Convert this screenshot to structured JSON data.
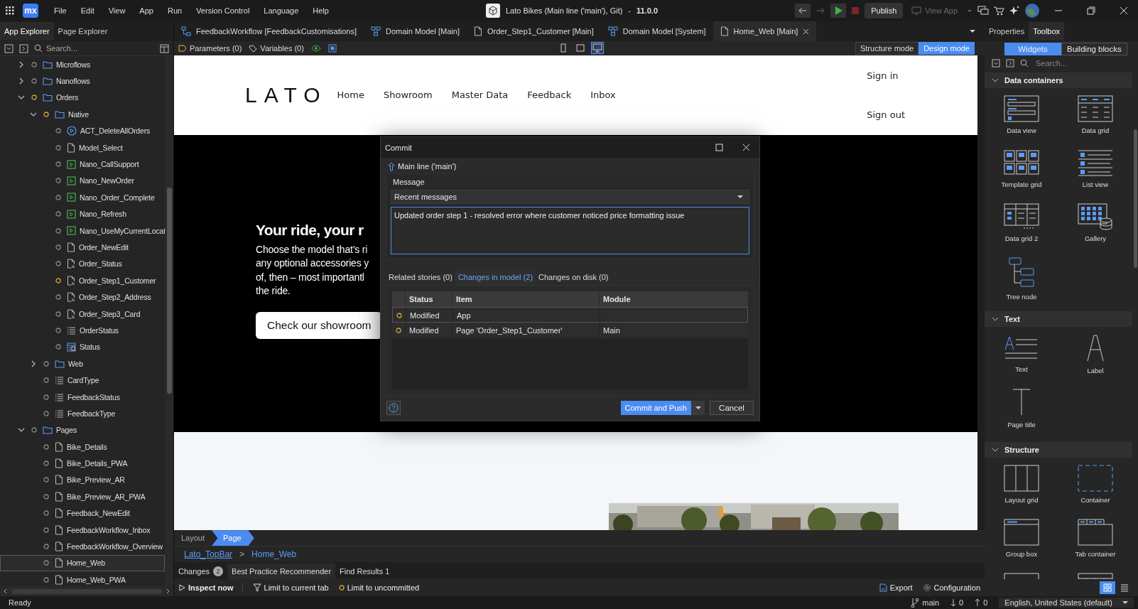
{
  "titlebar": {
    "logo": "mx",
    "menu": [
      "File",
      "Edit",
      "View",
      "App",
      "Run",
      "Version Control",
      "Language",
      "Help"
    ],
    "app_title": "Lato Bikes (Main line ('main'), Git)",
    "separator": "-",
    "version": "11.0.0",
    "publish": "Publish",
    "view_app": {
      "label": "View App",
      "disabled": true
    }
  },
  "explorer": {
    "tabs": [
      {
        "label": "App Explorer",
        "selected": true
      },
      {
        "label": "Page Explorer",
        "selected": false
      }
    ],
    "search": {
      "placeholder": "Search..."
    },
    "tree": [
      {
        "label": "Microflows",
        "kind": "folder",
        "modified": false,
        "expanded": false,
        "selected": false
      },
      {
        "label": "Nanoflows",
        "kind": "folder",
        "modified": false,
        "expanded": false,
        "selected": false
      },
      {
        "label": "Orders",
        "kind": "folder",
        "modified": true,
        "expanded": true,
        "selected": false,
        "children": [
          {
            "label": "Native",
            "kind": "folder",
            "modified": true,
            "expanded": true,
            "selected": false,
            "children": [
              {
                "label": "ACT_DeleteAllOrders",
                "kind": "microflow",
                "modified": false,
                "selected": false
              },
              {
                "label": "Model_Select",
                "kind": "page",
                "modified": false,
                "selected": false
              },
              {
                "label": "Nano_CallSupport",
                "kind": "nanoflow",
                "modified": false,
                "selected": false
              },
              {
                "label": "Nano_NewOrder",
                "kind": "nanoflow",
                "modified": false,
                "selected": false
              },
              {
                "label": "Nano_Order_Complete",
                "kind": "nanoflow",
                "modified": false,
                "selected": false
              },
              {
                "label": "Nano_Refresh",
                "kind": "nanoflow",
                "modified": false,
                "selected": false
              },
              {
                "label": "Nano_UseMyCurrentLocat",
                "kind": "nanoflow",
                "modified": false,
                "selected": false
              },
              {
                "label": "Order_NewEdit",
                "kind": "page",
                "modified": false,
                "selected": false
              },
              {
                "label": "Order_Status",
                "kind": "page-params",
                "modified": false,
                "selected": false
              },
              {
                "label": "Order_Step1_Customer",
                "kind": "page-params",
                "modified": true,
                "selected": false
              },
              {
                "label": "Order_Step2_Address",
                "kind": "page-params",
                "modified": false,
                "selected": false
              },
              {
                "label": "Order_Step3_Card",
                "kind": "page-params",
                "modified": false,
                "selected": false
              },
              {
                "label": "OrderStatus",
                "kind": "enumeration",
                "modified": false,
                "selected": false
              },
              {
                "label": "Status",
                "kind": "entity",
                "modified": false,
                "selected": false
              }
            ]
          },
          {
            "label": "Web",
            "kind": "folder",
            "modified": false,
            "expanded": false,
            "selected": false
          },
          {
            "label": "CardType",
            "kind": "enumeration",
            "modified": false,
            "selected": false
          },
          {
            "label": "FeedbackStatus",
            "kind": "enumeration",
            "modified": false,
            "selected": false
          },
          {
            "label": "FeedbackType",
            "kind": "enumeration",
            "modified": false,
            "selected": false
          }
        ]
      },
      {
        "label": "Pages",
        "kind": "folder",
        "modified": false,
        "expanded": true,
        "selected": false,
        "children": [
          {
            "label": "Bike_Details",
            "kind": "page",
            "modified": false,
            "selected": false
          },
          {
            "label": "Bike_Details_PWA",
            "kind": "page",
            "modified": false,
            "selected": false
          },
          {
            "label": "Bike_Preview_AR",
            "kind": "page",
            "modified": false,
            "selected": false
          },
          {
            "label": "Bike_Preview_AR_PWA",
            "kind": "page",
            "modified": false,
            "selected": false
          },
          {
            "label": "Feedback_NewEdit",
            "kind": "page",
            "modified": false,
            "selected": false
          },
          {
            "label": "FeedbackWorkflow_Inbox",
            "kind": "page",
            "modified": false,
            "selected": false
          },
          {
            "label": "FeedbackWorkflow_Overview",
            "kind": "page",
            "modified": false,
            "selected": false
          },
          {
            "label": "Home_Web",
            "kind": "page",
            "modified": false,
            "selected": true
          },
          {
            "label": "Home_Web_PWA",
            "kind": "page",
            "modified": false,
            "selected": false
          }
        ]
      }
    ]
  },
  "editor": {
    "tabs": [
      {
        "label": "FeedbackWorkflow [FeedbackCustomisations]",
        "kind": "workflow",
        "selected": false
      },
      {
        "label": "Domain Model [Main]",
        "kind": "domain-model",
        "selected": false
      },
      {
        "label": "Order_Step1_Customer [Main]",
        "kind": "page",
        "selected": false
      },
      {
        "label": "Domain Model [System]",
        "kind": "domain-model",
        "selected": false
      },
      {
        "label": "Home_Web [Main]",
        "kind": "page",
        "selected": true
      }
    ],
    "toolbar": {
      "parameters": "Parameters (0)",
      "variables": "Variables (0)",
      "devices": [
        {
          "kind": "phone",
          "selected": false
        },
        {
          "kind": "tablet",
          "selected": false
        },
        {
          "kind": "desktop",
          "selected": true
        }
      ],
      "modes": [
        {
          "label": "Structure mode",
          "selected": false
        },
        {
          "label": "Design mode",
          "selected": true
        }
      ]
    },
    "preview": {
      "logo": "LATO",
      "nav": [
        "Home",
        "Showroom",
        "Master Data",
        "Feedback",
        "Inbox"
      ],
      "account": [
        "Sign in",
        "Sign out"
      ],
      "hero": {
        "heading": "Your ride, your r",
        "lines": [
          "Choose the model that’s ri",
          "any optional accessories y",
          "of, then – most importantl",
          "the ride."
        ],
        "button": "Check our showroom"
      },
      "photo": {
        "kind": "picture"
      }
    },
    "breadcrumb": [
      {
        "label": "Layout",
        "selected": false
      },
      {
        "label": "Page",
        "selected": true
      }
    ],
    "path": [
      {
        "label": "Lato_TopBar",
        "kind": "link"
      },
      {
        "label": "Home_Web",
        "kind": "current"
      }
    ],
    "path_separator": ">"
  },
  "bottom_panel": {
    "tabs": [
      {
        "label": "Changes",
        "badge": "2",
        "selected": false
      },
      {
        "label": "Best Practice Recommender",
        "selected": true
      },
      {
        "label": "Find Results 1",
        "selected": false
      }
    ],
    "actions": [
      {
        "label": "Inspect now",
        "kind": "run"
      },
      {
        "label": "Limit to current tab",
        "kind": "filter"
      },
      {
        "label": "Limit to uncommitted",
        "kind": "uncommitted"
      }
    ],
    "right_actions": [
      {
        "label": "Export",
        "kind": "export"
      },
      {
        "label": "Configuration",
        "kind": "settings"
      }
    ]
  },
  "toolbox": {
    "tabs": [
      {
        "label": "Properties",
        "selected": false
      },
      {
        "label": "Toolbox",
        "selected": true
      }
    ],
    "modes": [
      {
        "label": "Widgets",
        "selected": true
      },
      {
        "label": "Building blocks",
        "selected": false
      }
    ],
    "search": {
      "placeholder": "Search..."
    },
    "sections": [
      {
        "title": "Data containers",
        "expanded": true,
        "widgets": [
          {
            "label": "Data view",
            "kind": "data-view"
          },
          {
            "label": "Data grid",
            "kind": "data-grid"
          },
          {
            "label": "Template grid",
            "kind": "template-grid"
          },
          {
            "label": "List view",
            "kind": "list-view"
          },
          {
            "label": "Data grid 2",
            "kind": "data-grid-2"
          },
          {
            "label": "Gallery",
            "kind": "gallery"
          },
          {
            "label": "Tree node",
            "kind": "tree-node"
          }
        ]
      },
      {
        "title": "Text",
        "expanded": true,
        "widgets": [
          {
            "label": "Text",
            "kind": "text"
          },
          {
            "label": "Label",
            "kind": "label"
          },
          {
            "label": "Page title",
            "kind": "page-title"
          }
        ]
      },
      {
        "title": "Structure",
        "expanded": true,
        "widgets": [
          {
            "label": "Layout grid",
            "kind": "layout-grid"
          },
          {
            "label": "Container",
            "kind": "container"
          },
          {
            "label": "Group box",
            "kind": "group-box"
          },
          {
            "label": "Tab container",
            "kind": "tab-container"
          },
          {
            "kind": "triangle-box"
          },
          {
            "kind": "table-box"
          }
        ]
      }
    ],
    "view_modes": [
      {
        "kind": "grid",
        "selected": true
      },
      {
        "kind": "list",
        "selected": false
      }
    ]
  },
  "statusbar": {
    "status": "Ready",
    "branch": "main",
    "incoming": "0",
    "outgoing": "0",
    "language": "English, United States (default)"
  },
  "dialog": {
    "title": "Commit",
    "branch": "Main line ('main')",
    "message_label": "Message",
    "recent": "Recent messages",
    "message": "Updated order step 1 - resolved error where customer noticed price formatting issue",
    "tabs": [
      {
        "label": "Related stories (0)",
        "selected": false
      },
      {
        "label": "Changes in model (2)",
        "selected": true
      },
      {
        "label": "Changes on disk (0)",
        "selected": false
      }
    ],
    "columns": [
      "Status",
      "Item",
      "Module"
    ],
    "rows": [
      {
        "modified": true,
        "status": "Modified",
        "item": "App",
        "selected": true
      },
      {
        "modified": true,
        "status": "Modified",
        "item": "Page 'Order_Step1_Customer'",
        "module": "Main",
        "selected": false
      }
    ],
    "primary": "Commit and Push",
    "cancel": "Cancel"
  }
}
